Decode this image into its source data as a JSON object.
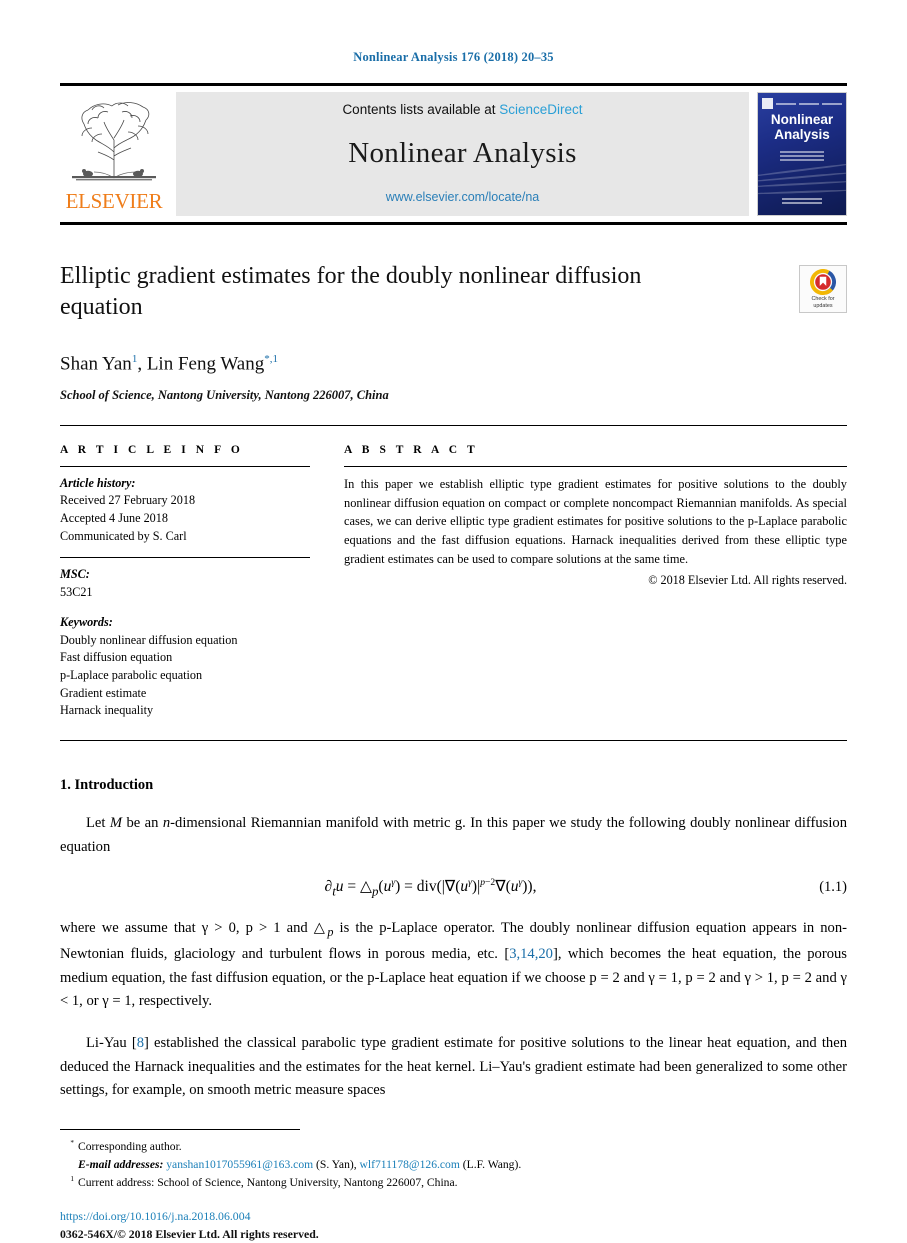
{
  "running_head": "Nonlinear Analysis 176 (2018) 20–35",
  "masthead": {
    "publisher_wordmark": "ELSEVIER",
    "contents_prefix": "Contents lists available at ",
    "contents_link": "ScienceDirect",
    "journal_name": "Nonlinear Analysis",
    "journal_url": "www.elsevier.com/locate/na",
    "cover_title_line1": "Nonlinear",
    "cover_title_line2": "Analysis"
  },
  "article": {
    "title": "Elliptic gradient estimates for the doubly nonlinear diffusion equation",
    "authors_plain": "Shan Yan, Lin Feng Wang",
    "author1_name": "Shan Yan",
    "author1_marks": "1",
    "author_sep": ", ",
    "author2_name": "Lin Feng Wang",
    "author2_marks": "*,1",
    "affiliation": "School of Science, Nantong University, Nantong 226007, China"
  },
  "crossmark": {
    "line1": "Check for",
    "line2": "updates"
  },
  "info": {
    "heading": "A R T I C L E   I N F O",
    "history_label": "Article history:",
    "history_lines": [
      "Received 27 February 2018",
      "Accepted 4 June 2018",
      "Communicated by S. Carl"
    ],
    "msc_label": "MSC:",
    "msc_value": "53C21",
    "keywords_label": "Keywords:",
    "keywords": [
      "Doubly nonlinear diffusion equation",
      "Fast diffusion equation",
      "p-Laplace parabolic equation",
      "Gradient estimate",
      "Harnack inequality"
    ]
  },
  "abstract": {
    "heading": "A B S T R A C T",
    "text": "In this paper we establish elliptic type gradient estimates for positive solutions to the doubly nonlinear diffusion equation on compact or complete noncompact Riemannian manifolds. As special cases, we can derive elliptic type gradient estimates for positive solutions to the p-Laplace parabolic equations and the fast diffusion equations. Harnack inequalities derived from these elliptic type gradient estimates can be used to compare solutions at the same time.",
    "copyright": "© 2018 Elsevier Ltd. All rights reserved."
  },
  "body": {
    "section_title": "1. Introduction",
    "par1_a": "Let ",
    "par1_M": "M",
    "par1_b": " be an ",
    "par1_n": "n",
    "par1_c": "-dimensional Riemannian manifold with metric g. In this paper we study the following doubly nonlinear diffusion equation",
    "equation_number": "(1.1)",
    "par2_pre": "where we assume that γ > 0, p > 1 and △",
    "par2_sub": "p",
    "par2_mid": " is the p-Laplace operator. The doubly nonlinear diffusion equation appears in non-Newtonian fluids, glaciology and turbulent flows in porous media, etc. [",
    "par2_ref": "3,14,20",
    "par2_post": "], which becomes the heat equation, the porous medium equation, the fast diffusion equation, or the p-Laplace heat equation if we choose p = 2 and γ = 1, p = 2 and γ > 1, p = 2 and γ < 1, or γ = 1, respectively.",
    "par3_pre": "Li-Yau [",
    "par3_ref": "8",
    "par3_post": "] established the classical parabolic type gradient estimate for positive solutions to the linear heat equation, and then deduced the Harnack inequalities and the estimates for the heat kernel. Li–Yau's gradient estimate had been generalized to some other settings, for example, on smooth metric measure spaces"
  },
  "footnotes": {
    "corresponding_mark": "*",
    "corresponding_text": "Corresponding author.",
    "email_label": "E-mail addresses:",
    "email1": "yanshan1017055961@163.com",
    "email1_who": "(S. Yan),",
    "email2": "wlf711178@126.com",
    "email2_who": "(L.F. Wang).",
    "fn1_mark": "1",
    "fn1_text": "Current address: School of Science, Nantong University, Nantong 226007, China.",
    "doi": "https://doi.org/10.1016/j.na.2018.06.004",
    "issn_line": "0362-546X/© 2018 Elsevier Ltd. All rights reserved."
  },
  "colors": {
    "link_blue": "#1a7fb8",
    "head_blue": "#1a6ea8",
    "elsevier_orange": "#ef7d1a",
    "band_grey": "#e7e7e7",
    "cover_blue": "#1c2d86"
  }
}
